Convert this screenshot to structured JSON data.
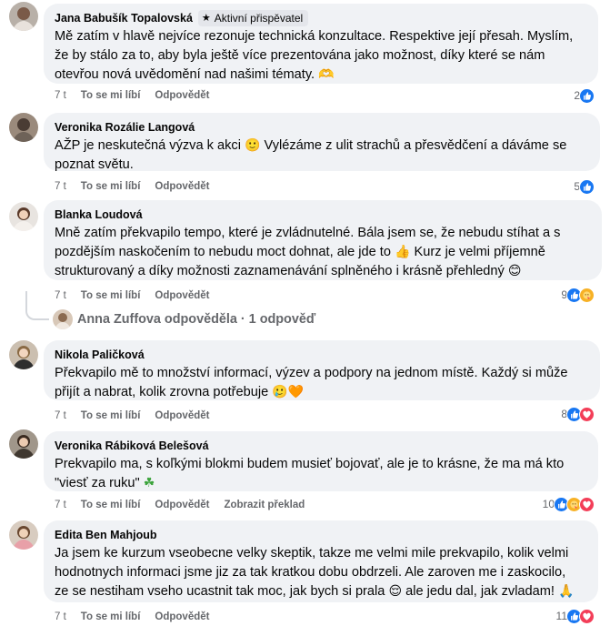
{
  "colors": {
    "bubble": "#f0f2f5",
    "secondary_text": "#65676b",
    "like": "#1877f2",
    "love": "#f33e58",
    "care": "#f7b125"
  },
  "actions_labels": {
    "like": "To se mi líbí",
    "reply": "Odpovědět",
    "translate": "Zobrazit překlad"
  },
  "comments": [
    {
      "author": "Jana Babušík Topalovská",
      "badge": "Aktivní přispěvatel",
      "lines": [
        "Mě zatím v hlavě nejvíce rezonuje technická konzultace. Respektive její přesah. Myslím,",
        "že by stálo za to, aby byla ještě více prezentována jako možnost, díky které se nám",
        "otevřou nová uvědomění nad našimi tématy."
      ],
      "emoji": "🫶",
      "time": "7 t",
      "reactions_count": "2",
      "reactions": [
        "like-icon"
      ]
    },
    {
      "author": "Veronika Rozálie Langová",
      "lines": [
        "AŽP je neskutečná výzva k akci",
        "poznat světu."
      ],
      "line1_tail": "Vylézáme z ulit strachů a přesvědčení a dáváme se",
      "emoji": "🙂",
      "time": "7 t",
      "reactions_count": "5",
      "reactions": [
        "like-icon"
      ]
    },
    {
      "author": "Blanka Loudová",
      "lines": [
        "Mně zatím překvapilo tempo, které je zvládnutelné. Bála jsem se, že nebudu stíhat a s",
        "pozdějším naskočením to nebudu moct dohnat, ale jde to",
        "strukturovaný a díky možnosti zaznamenávání splněného i krásně přehledný"
      ],
      "line2_tail": "Kurz je velmi příjemně",
      "emoji_mid": "👍",
      "emoji": "😊",
      "time": "7 t",
      "reactions_count": "9",
      "reactions": [
        "like-icon",
        "care-icon"
      ],
      "replies_text": "Anna Zuffova odpověděla · 1 odpověď"
    },
    {
      "author": "Nikola Paličková",
      "lines": [
        "Překvapilo mě to množství informací, výzev a podpory na jednom místě. Každý si může",
        "přijít a nabrat, kolik zrovna potřebuje"
      ],
      "emoji": "🥲🧡",
      "time": "7 t",
      "reactions_count": "8",
      "reactions": [
        "like-icon",
        "love-icon"
      ]
    },
    {
      "author": "Veronika Rábiková Belešová",
      "lines": [
        "Prekvapilo ma, s koľkými blokmi budem musieť bojovať, ale je to krásne, že ma má kto",
        "\"viesť za ruku\""
      ],
      "emoji": "☘",
      "time": "7 t",
      "reactions_count": "10",
      "reactions": [
        "like-icon",
        "care-icon",
        "love-icon"
      ],
      "translate": true
    },
    {
      "author": "Edita Ben Mahjoub",
      "lines": [
        "Ja jsem ke kurzum vseobecne velky skeptik, takze me velmi mile prekvapilo, kolik velmi",
        "hodnotnych informaci jsme jiz za tak kratkou dobu obdrzeli. Ale zaroven me i zaskocilo,",
        "ze se nestiham vseho ucastnit tak moc, jak bych si prala",
        "ale jedu dal, jak zvladam!"
      ],
      "emoji_mid": "😌",
      "emoji": "🙏",
      "time": "7 t",
      "reactions_count": "11",
      "reactions": [
        "like-icon",
        "love-icon"
      ]
    }
  ]
}
